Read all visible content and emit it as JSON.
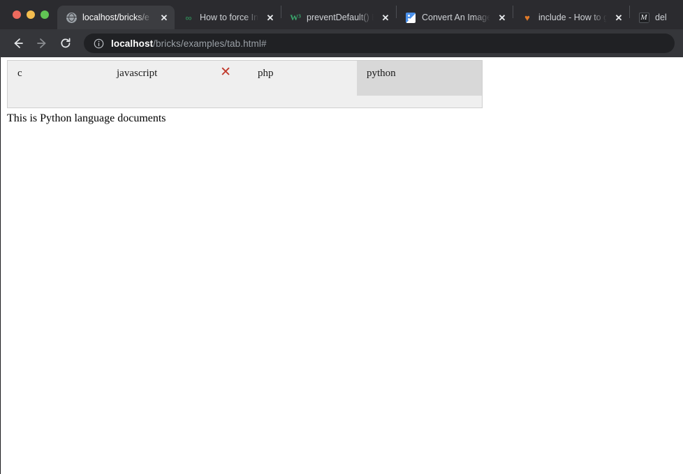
{
  "window": {
    "traffic_lights": [
      {
        "name": "close",
        "color": "#ed6a5e"
      },
      {
        "name": "minimize",
        "color": "#f4bd4f"
      },
      {
        "name": "maximize",
        "color": "#61c554"
      }
    ]
  },
  "browser_tabs": [
    {
      "title": "localhost/bricks/e",
      "favicon": "globe-icon",
      "active": true,
      "close_label": "✕"
    },
    {
      "title": "How to force Input",
      "favicon": "infinity-icon",
      "active": false,
      "close_label": "✕"
    },
    {
      "title": "preventDefault() E",
      "favicon": "w3-icon",
      "active": false,
      "close_label": "✕"
    },
    {
      "title": "Convert An Image",
      "favicon": "document-icon",
      "active": false,
      "close_label": "✕"
    },
    {
      "title": "include - How to g",
      "favicon": "java-icon",
      "active": false,
      "close_label": "✕"
    },
    {
      "title": "del",
      "favicon": "m-icon",
      "active": false,
      "close_label": ""
    }
  ],
  "toolbar": {
    "back_label": "←",
    "forward_label": "→",
    "reload_label": "↻",
    "info_label": "ⓘ",
    "url_host": "localhost",
    "url_path": "/bricks/examples/tab.html#"
  },
  "page": {
    "tabs": [
      {
        "label": "c",
        "active": false,
        "closable": false
      },
      {
        "label": "javascript",
        "active": false,
        "closable": true,
        "close_label": "✕"
      },
      {
        "label": "php",
        "active": false,
        "closable": false
      },
      {
        "label": "python",
        "active": true,
        "closable": false
      }
    ],
    "content": "This is Python language documents"
  },
  "colors": {
    "tab_strip_bg": "#2b2b2f",
    "toolbar_bg": "#35363a",
    "url_pill_bg": "#202124",
    "widget_bg": "#efefef",
    "active_tab_bg": "#d8d8d8",
    "close_red": "#c0392b"
  }
}
